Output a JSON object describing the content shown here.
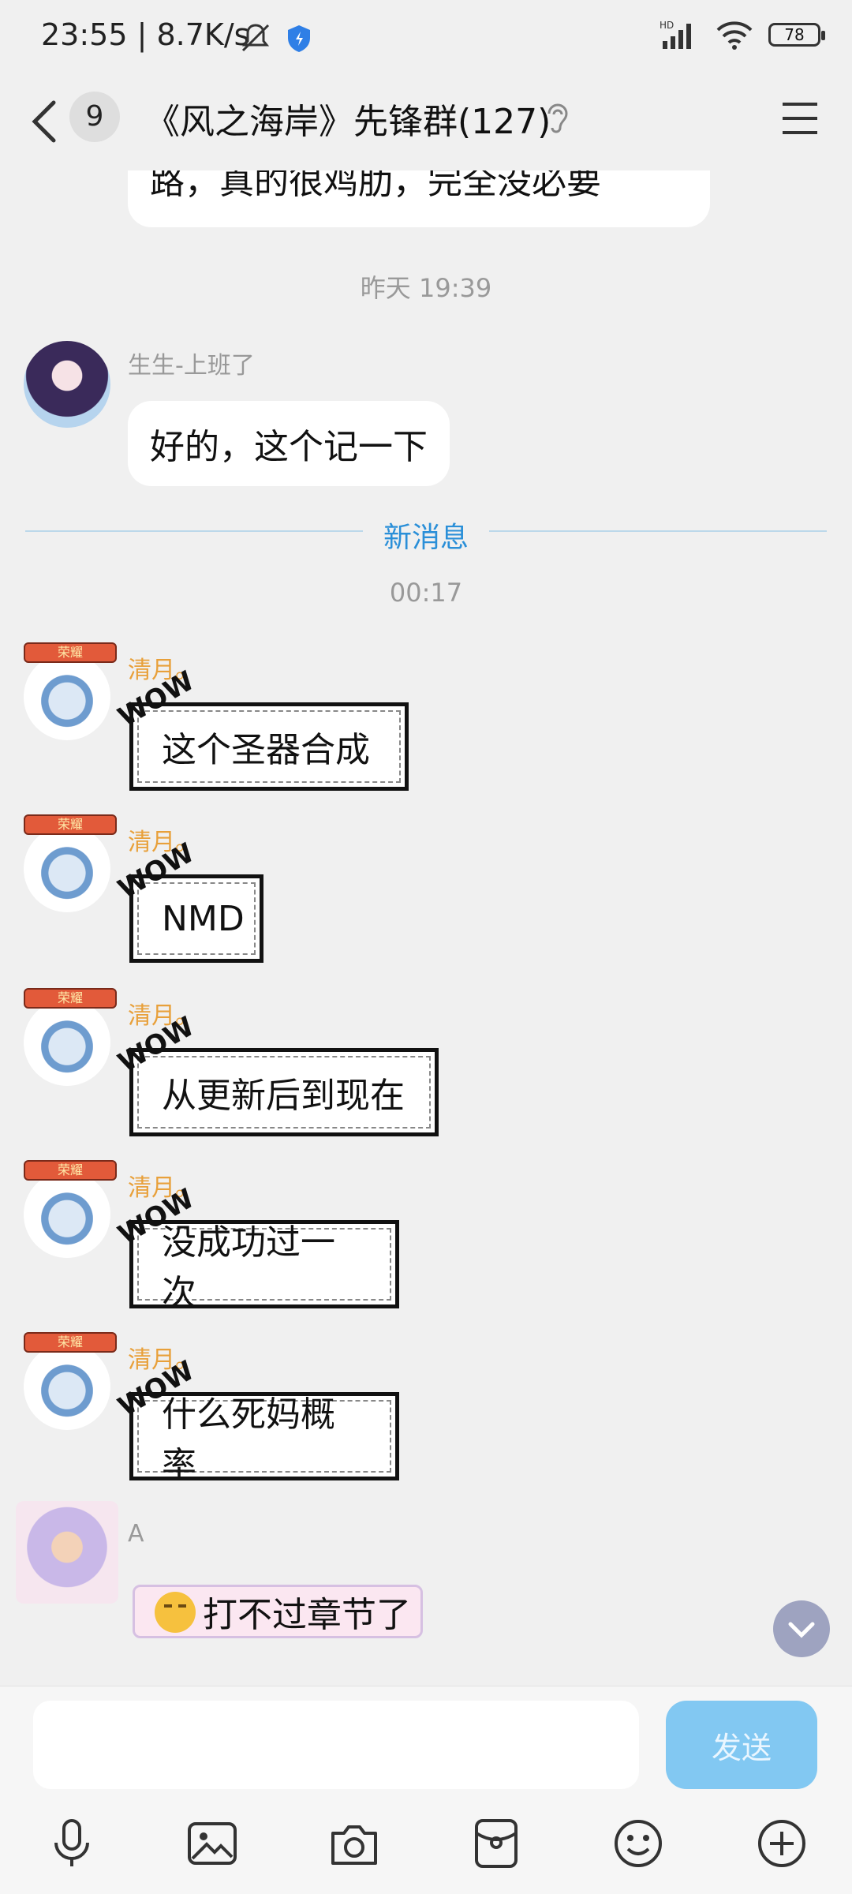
{
  "status_bar": {
    "time": "23:55 | 8.7K/s",
    "battery": "78",
    "network_label": "HD"
  },
  "header": {
    "unread_count": "9",
    "title": "《风之海岸》先锋群(127)"
  },
  "messages": {
    "top_bubble_text": "路，真的很鸡肋，完全没必要",
    "time_1": "昨天 19:39",
    "sender_1": "生生-上班了",
    "msg_1": "好的，这个记一下",
    "new_messages_label": "新消息",
    "time_2": "00:17",
    "qingyue": [
      {
        "name": "清月。",
        "text": "这个圣器合成"
      },
      {
        "name": "清月。",
        "text": "NMD"
      },
      {
        "name": "清月。",
        "text": "从更新后到现在"
      },
      {
        "name": "清月。",
        "text": "没成功过一次"
      },
      {
        "name": "清月。",
        "text": "什么死妈概率"
      }
    ],
    "wow_tag": "WOW",
    "avatar_badge": "荣耀",
    "sender_a": "A",
    "msg_a": "打不过章节了"
  },
  "input_bar": {
    "placeholder": "",
    "send_label": "发送"
  },
  "colors": {
    "accent": "#2a8fd8",
    "send_button": "#82c8f2",
    "nick_gold": "#e8a03a"
  }
}
